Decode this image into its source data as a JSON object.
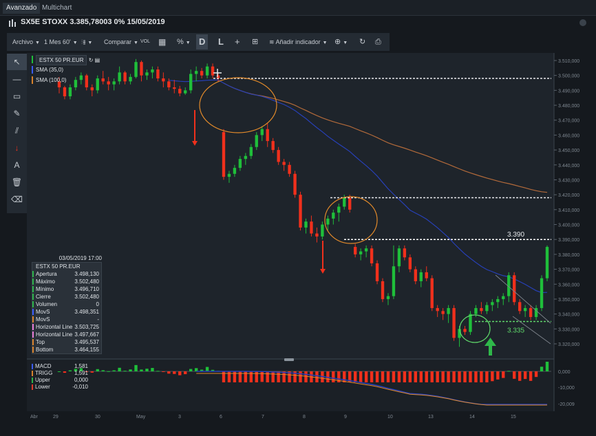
{
  "tabs": [
    "Avanzado",
    "Multichart"
  ],
  "title": "SX5E STOXX 3.385,78003 0% 15/05/2019",
  "toolbar": {
    "archivo": "Archivo",
    "period": "1 Mes 60'",
    "comparar": "Comparar",
    "vol": "VOL",
    "pct": "%",
    "d": "D",
    "l": "L",
    "indicator": "Añadir indicador"
  },
  "legend": {
    "symbol": "ESTX 50 PR.EUR",
    "sma1": "SMA (35,0)",
    "sma2": "SMA (100,0)"
  },
  "databox": {
    "header": "03/05/2019 17:00",
    "symbol": "ESTX 50 PR.EUR",
    "rows": [
      {
        "k": "Apertura",
        "v": "3.498,130",
        "c": "#2db34a"
      },
      {
        "k": "Máximo",
        "v": "3.502,480",
        "c": "#2db34a"
      },
      {
        "k": "Mínimo",
        "v": "3.496,710",
        "c": "#2db34a"
      },
      {
        "k": "Cierre",
        "v": "3.502,480",
        "c": "#2db34a"
      },
      {
        "k": "Volumen",
        "v": "0",
        "c": "#2db34a"
      },
      {
        "k": "MovS",
        "v": "3.498,351",
        "c": "#3a5cff"
      },
      {
        "k": "MovS",
        "v": "-",
        "c": "#d9822b"
      },
      {
        "k": "Horizontal Line",
        "v": "3.503,725",
        "c": "#e87bd6"
      },
      {
        "k": "Horizontal Line",
        "v": "3.497,667",
        "c": "#e87bd6"
      },
      {
        "k": "Top",
        "v": "3.495,537",
        "c": "#d9822b"
      },
      {
        "k": "Bottom",
        "v": "3.464,155",
        "c": "#d9822b"
      }
    ]
  },
  "macd_legend": [
    {
      "k": "MACD",
      "v": "1,581",
      "c": "#3a5cff"
    },
    {
      "k": "TRIGG",
      "v": "1,591",
      "c": "#d9822b"
    },
    {
      "k": "Upper",
      "v": "0,000",
      "c": "#2db34a"
    },
    {
      "k": "Lower",
      "v": "-0,010",
      "c": "#e03b2a"
    }
  ],
  "annotations": {
    "level_high": "3.390",
    "level_low": "3.335"
  },
  "colors": {
    "up": "#1fbf3a",
    "down": "#f0301c",
    "sma35": "#2740b8",
    "sma100": "#b36a3a",
    "accent": "#e28a2b"
  },
  "chart_data": {
    "type": "candlestick",
    "price_axis": {
      "min": 3320,
      "max": 3510,
      "step": 10,
      "ticks": [
        "3.320,000",
        "3.330,000",
        "3.340,000",
        "3.350,000",
        "3.360,000",
        "3.370,000",
        "3.380,000",
        "3.390,000",
        "3.400,000",
        "3.410,000",
        "3.420,000",
        "3.430,000",
        "3.440,000",
        "3.450,000",
        "3.460,000",
        "3.470,000",
        "3.480,000",
        "3.490,000",
        "3.500,000",
        "3.510,000"
      ]
    },
    "x_labels": [
      "Abr",
      "29",
      "30",
      "May",
      "3",
      "6",
      "7",
      "8",
      "9",
      "10",
      "13",
      "14",
      "15"
    ],
    "candles": [
      [
        3496,
        3499,
        3488,
        3492
      ],
      [
        3492,
        3493,
        3484,
        3486
      ],
      [
        3486,
        3494,
        3484,
        3492
      ],
      [
        3492,
        3499,
        3490,
        3497
      ],
      [
        3497,
        3502,
        3494,
        3500
      ],
      [
        3500,
        3501,
        3490,
        3492
      ],
      [
        3492,
        3494,
        3486,
        3490
      ],
      [
        3490,
        3500,
        3488,
        3498
      ],
      [
        3498,
        3503,
        3494,
        3496
      ],
      [
        3496,
        3499,
        3490,
        3494
      ],
      [
        3494,
        3498,
        3490,
        3496
      ],
      [
        3496,
        3506,
        3494,
        3502
      ],
      [
        3502,
        3503,
        3494,
        3496
      ],
      [
        3496,
        3501,
        3494,
        3499
      ],
      [
        3499,
        3511,
        3498,
        3509
      ],
      [
        3509,
        3510,
        3496,
        3500
      ],
      [
        3500,
        3504,
        3497,
        3502
      ],
      [
        3502,
        3506,
        3498,
        3504
      ],
      [
        3504,
        3506,
        3496,
        3498
      ],
      [
        3498,
        3502,
        3492,
        3496
      ],
      [
        3496,
        3498,
        3490,
        3492
      ],
      [
        3492,
        3497,
        3488,
        3491
      ],
      [
        3491,
        3493,
        3486,
        3488
      ],
      [
        3488,
        3492,
        3487,
        3490
      ],
      [
        3490,
        3504,
        3488,
        3501
      ],
      [
        3501,
        3506,
        3496,
        3503
      ],
      [
        3503,
        3505,
        3498,
        3500
      ],
      [
        3500,
        3508,
        3498,
        3506
      ],
      [
        3506,
        3508,
        3498,
        3500
      ],
      [
        3500,
        3502,
        3496,
        3498
      ],
      [
        3462,
        3464,
        3430,
        3432
      ],
      [
        3432,
        3436,
        3428,
        3434
      ],
      [
        3434,
        3440,
        3432,
        3438
      ],
      [
        3438,
        3446,
        3436,
        3444
      ],
      [
        3444,
        3448,
        3440,
        3446
      ],
      [
        3446,
        3454,
        3444,
        3452
      ],
      [
        3452,
        3462,
        3450,
        3460
      ],
      [
        3460,
        3466,
        3456,
        3464
      ],
      [
        3464,
        3468,
        3452,
        3456
      ],
      [
        3456,
        3458,
        3448,
        3450
      ],
      [
        3450,
        3452,
        3440,
        3442
      ],
      [
        3442,
        3444,
        3436,
        3440
      ],
      [
        3440,
        3442,
        3432,
        3434
      ],
      [
        3434,
        3436,
        3418,
        3420
      ],
      [
        3420,
        3422,
        3396,
        3398
      ],
      [
        3398,
        3404,
        3394,
        3402
      ],
      [
        3402,
        3406,
        3392,
        3394
      ],
      [
        3394,
        3398,
        3388,
        3392
      ],
      [
        3392,
        3402,
        3390,
        3400
      ],
      [
        3400,
        3406,
        3396,
        3404
      ],
      [
        3404,
        3410,
        3400,
        3408
      ],
      [
        3408,
        3414,
        3402,
        3412
      ],
      [
        3412,
        3420,
        3410,
        3418
      ],
      [
        3418,
        3420,
        3408,
        3410
      ],
      [
        3385,
        3387,
        3378,
        3380
      ],
      [
        3380,
        3384,
        3376,
        3382
      ],
      [
        3382,
        3386,
        3378,
        3384
      ],
      [
        3384,
        3386,
        3372,
        3374
      ],
      [
        3374,
        3376,
        3360,
        3362
      ],
      [
        3362,
        3364,
        3348,
        3350
      ],
      [
        3350,
        3354,
        3346,
        3352
      ],
      [
        3352,
        3386,
        3350,
        3372
      ],
      [
        3372,
        3386,
        3368,
        3384
      ],
      [
        3384,
        3386,
        3376,
        3378
      ],
      [
        3378,
        3380,
        3368,
        3370
      ],
      [
        3370,
        3372,
        3360,
        3362
      ],
      [
        3362,
        3370,
        3358,
        3368
      ],
      [
        3368,
        3372,
        3362,
        3364
      ],
      [
        3364,
        3366,
        3342,
        3344
      ],
      [
        3344,
        3346,
        3338,
        3342
      ],
      [
        3342,
        3344,
        3336,
        3340
      ],
      [
        3340,
        3346,
        3334,
        3344
      ],
      [
        3344,
        3346,
        3322,
        3324
      ],
      [
        3324,
        3332,
        3318,
        3330
      ],
      [
        3330,
        3332,
        3326,
        3328
      ],
      [
        3328,
        3342,
        3326,
        3340
      ],
      [
        3340,
        3346,
        3338,
        3344
      ],
      [
        3344,
        3348,
        3340,
        3342
      ],
      [
        3342,
        3348,
        3340,
        3346
      ],
      [
        3346,
        3350,
        3342,
        3348
      ],
      [
        3348,
        3352,
        3344,
        3350
      ],
      [
        3350,
        3354,
        3346,
        3352
      ],
      [
        3352,
        3368,
        3348,
        3366
      ],
      [
        3366,
        3368,
        3346,
        3348
      ],
      [
        3348,
        3350,
        3340,
        3342
      ],
      [
        3342,
        3346,
        3338,
        3344
      ],
      [
        3344,
        3346,
        3336,
        3338
      ],
      [
        3338,
        3346,
        3336,
        3344
      ],
      [
        3344,
        3366,
        3342,
        3364
      ],
      [
        3364,
        3386,
        3362,
        3385
      ]
    ],
    "macd_axis": {
      "ticks": [
        "0,000",
        "-10,000",
        "-20,009"
      ]
    }
  }
}
